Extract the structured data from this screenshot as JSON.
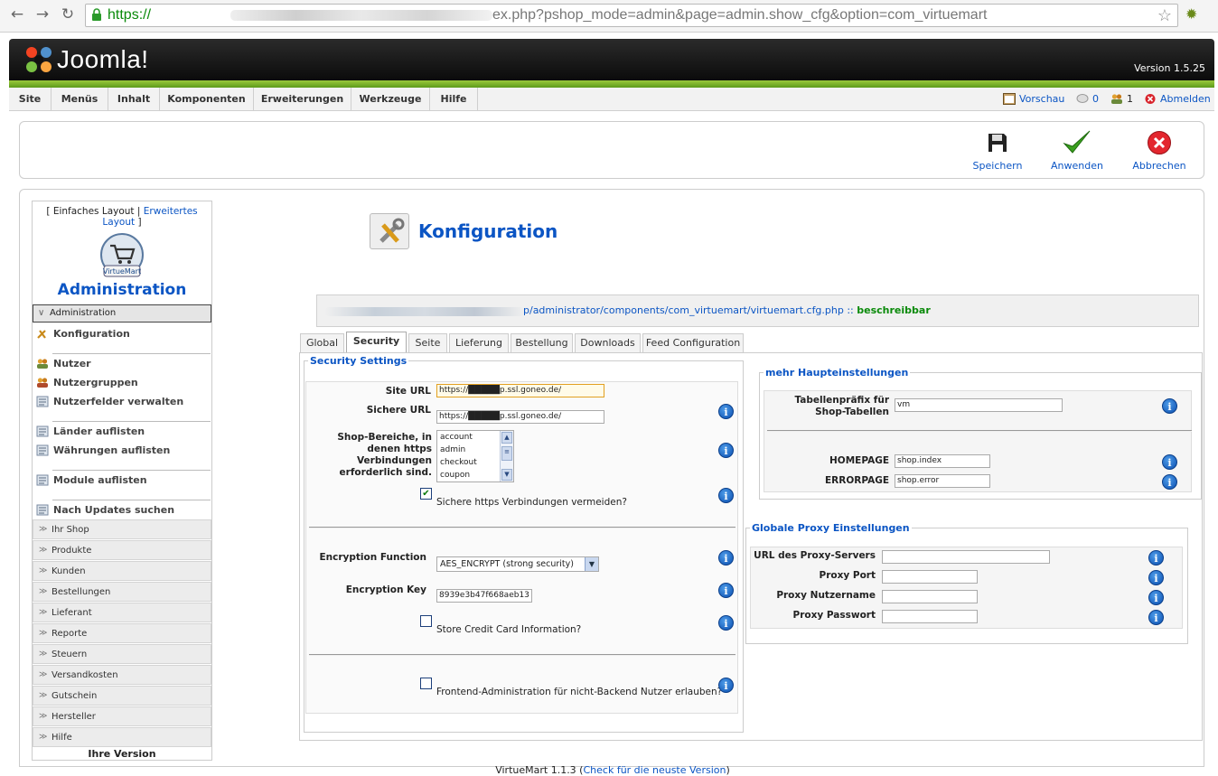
{
  "browser": {
    "url_scheme": "https://",
    "url_rest": "ex.php?pshop_mode=admin&page=admin.show_cfg&option=com_virtuemart"
  },
  "header": {
    "logo_text": "Joomla!",
    "version": "Version 1.5.25"
  },
  "menu": {
    "items": [
      "Site",
      "Menüs",
      "Inhalt",
      "Komponenten",
      "Erweiterungen",
      "Werkzeuge",
      "Hilfe"
    ],
    "preview": "Vorschau",
    "messages_count": "0",
    "users_count": "1",
    "logout": "Abmelden"
  },
  "toolbar": {
    "save": "Speichern",
    "apply": "Anwenden",
    "cancel": "Abbrechen"
  },
  "sidebar": {
    "layout_prefix": "[",
    "simple_layout": "Einfaches Layout",
    "separator": "|",
    "advanced_layout": "Erweitertes Layout",
    "layout_suffix": "]",
    "logo_text": "VirtueMart",
    "title": "Administration",
    "open_section": "Administration",
    "items": [
      "Konfiguration",
      "Nutzer",
      "Nutzergruppen",
      "Nutzerfelder verwalten",
      "Länder auflisten",
      "Währungen auflisten",
      "Module auflisten",
      "Nach Updates suchen"
    ],
    "sections": [
      "Ihr Shop",
      "Produkte",
      "Kunden",
      "Bestellungen",
      "Lieferant",
      "Reporte",
      "Steuern",
      "Versandkosten",
      "Gutschein",
      "Hersteller",
      "Hilfe"
    ],
    "your_version": "Ihre Version"
  },
  "page": {
    "title": "Konfiguration",
    "path": "p/administrator/components/com_virtuemart/virtuemart.cfg.php ::",
    "path_status": "beschreibbar"
  },
  "tabs": [
    "Global",
    "Security",
    "Seite",
    "Lieferung",
    "Bestellung",
    "Downloads",
    "Feed Configuration"
  ],
  "security": {
    "legend": "Security Settings",
    "site_url_label": "Site URL",
    "site_url_value": "https://█████p.ssl.goneo.de/",
    "secure_url_label": "Sichere URL",
    "secure_url_value": "https://█████p.ssl.goneo.de/",
    "https_areas_label": "Shop-Bereiche, in denen https Verbindungen erforderlich sind.",
    "https_areas": [
      "account",
      "admin",
      "checkout",
      "coupon"
    ],
    "avoid_https_label": "Sichere https Verbindungen vermeiden?",
    "avoid_https_checked": "✔",
    "encryption_function_label": "Encryption Function",
    "encryption_function_value": "AES_ENCRYPT (strong security)",
    "encryption_key_label": "Encryption Key",
    "encryption_key_value": "8939e3b47f668aeb13",
    "store_cc_label": "Store Credit Card Information?",
    "frontend_admin_label": "Frontend-Administration für nicht-Backend Nutzer erlauben?"
  },
  "main_settings": {
    "legend": "mehr Haupteinstellungen",
    "table_prefix_label": "Tabellenpräfix für Shop-Tabellen",
    "table_prefix_value": "vm",
    "homepage_label": "HOMEPAGE",
    "homepage_value": "shop.index",
    "errorpage_label": "ERRORPAGE",
    "errorpage_value": "shop.error"
  },
  "proxy": {
    "legend": "Globale Proxy Einstellungen",
    "url_label": "URL des Proxy-Servers",
    "port_label": "Proxy Port",
    "user_label": "Proxy Nutzername",
    "password_label": "Proxy Passwort"
  },
  "footer": {
    "text": "VirtueMart 1.1.3 (",
    "link": "Check für die neuste Version",
    "suffix": ")"
  },
  "colors": {
    "link_blue": "#0b55c4",
    "joomla_green": "#7ab52b",
    "writable_green": "#0a8a0a"
  }
}
